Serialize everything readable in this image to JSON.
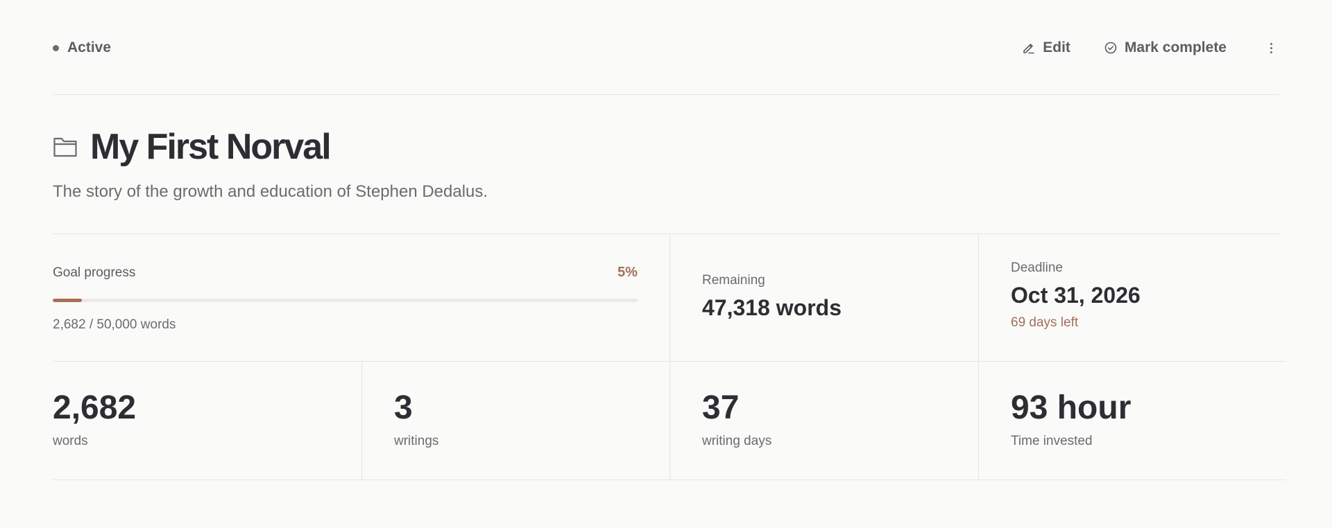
{
  "header": {
    "status": "Active",
    "edit_label": "Edit",
    "mark_complete_label": "Mark complete",
    "icons": {
      "edit": "pencil-icon",
      "mark_complete": "check-circle-icon",
      "more": "more-vertical-icon"
    }
  },
  "project": {
    "title": "My First Norval",
    "description": "The story of the growth and education of Stephen Dedalus.",
    "icon": "folder-icon"
  },
  "goal": {
    "label": "Goal progress",
    "percent_text": "5%",
    "progress_fraction": 0.05,
    "current_words": 2682,
    "target_words": 50000,
    "summary": "2,682 / 50,000 words"
  },
  "remaining": {
    "label": "Remaining",
    "value": "47,318 words"
  },
  "deadline": {
    "label": "Deadline",
    "date": "Oct 31, 2026",
    "days_left": "69 days left"
  },
  "metrics": [
    {
      "value": "2,682",
      "label": "words"
    },
    {
      "value": "3",
      "label": "writings"
    },
    {
      "value": "37",
      "label": "writing days"
    },
    {
      "value": "93 hour",
      "label": "Time invested"
    }
  ],
  "colors": {
    "background": "#fafaf8",
    "text": "#2d2d33",
    "muted": "#6b6b70",
    "accent": "#a86e58",
    "divider": "#e6e5e1"
  }
}
